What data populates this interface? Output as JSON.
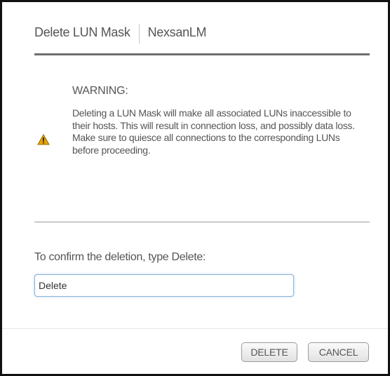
{
  "dialog": {
    "title": "Delete LUN Mask",
    "subtitle": "NexsanLM"
  },
  "warning": {
    "heading": "WARNING:",
    "icon": "warning-triangle-icon",
    "icon_color": "#e8a400",
    "message": "Deleting a LUN Mask will make all associated LUNs inaccessible to their hosts. This will result in connection loss, and possibly data loss. Make sure to quiesce all connections to the corresponding LUNs before proceeding."
  },
  "confirm": {
    "label": "To confirm the deletion, type Delete:",
    "value": "Delete"
  },
  "footer": {
    "delete_label": "DELETE",
    "cancel_label": "CANCEL"
  }
}
